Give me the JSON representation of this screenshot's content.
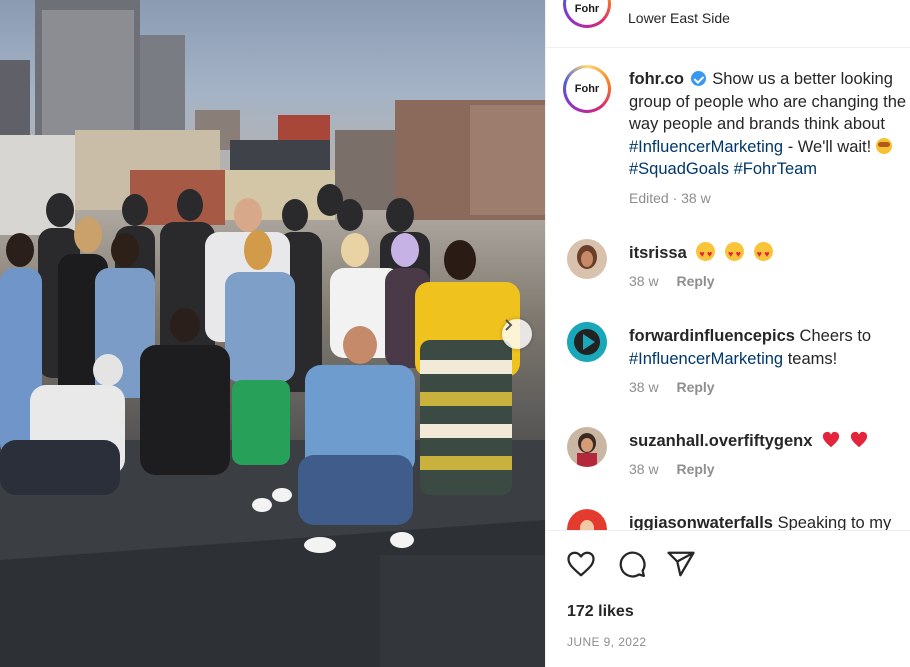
{
  "post": {
    "account_logo_text": "Fohr",
    "location": "Lower East Side"
  },
  "caption": {
    "username": "fohr.co",
    "text_1": "Show us a better looking group of people who are changing the way people and brands think about",
    "hashtag_1": "#InfluencerMarketing",
    "text_2": "- We'll wait!",
    "hashtag_2": "#SquadGoals",
    "hashtag_3": "#FohrTeam",
    "meta": "Edited · 38 w"
  },
  "comments": [
    {
      "username": "itsrissa",
      "text": "",
      "emoji": "heart-eyes x3",
      "time": "38 w",
      "reply_label": "Reply"
    },
    {
      "username": "forwardinfluencepics",
      "text": "Cheers to",
      "hashtag": "#InfluencerMarketing",
      "text_after": "teams!",
      "time": "38 w",
      "reply_label": "Reply"
    },
    {
      "username": "suzanhall.overfiftygenx",
      "text": "",
      "emoji": "red heart x2",
      "time": "38 w",
      "reply_label": "Reply"
    },
    {
      "username": "iggiasonwaterfalls",
      "text": "Speaking to my"
    }
  ],
  "footer": {
    "likes": "172 likes",
    "date": "JUNE 9, 2022"
  },
  "colors": {
    "link": "#00376b",
    "muted": "#8e8e8e",
    "verified": "#3897f0",
    "like_heart": "#e3243b"
  },
  "icons": [
    "heart-icon",
    "comment-icon",
    "share-icon",
    "verified-badge-icon",
    "carousel-next-icon"
  ]
}
